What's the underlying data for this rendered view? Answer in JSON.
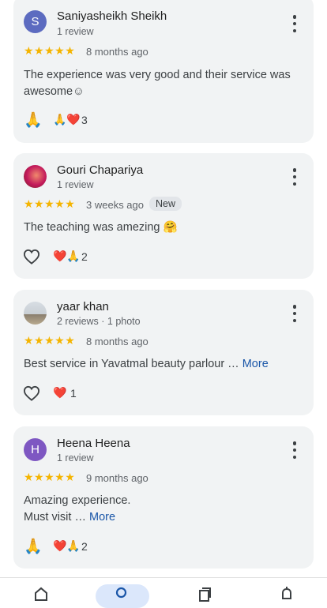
{
  "reviews": [
    {
      "avatar_letter": "S",
      "avatar_color": "#5c6bc0",
      "name": "Saniyasheikh Sheikh",
      "meta": "1 review",
      "stars": "★★★★★",
      "ago": "8 months ago",
      "text": "The experience was very good and their service was awesome☺",
      "reaction_icon": "🙏",
      "reactions": "🙏❤️",
      "count": "3"
    },
    {
      "name": "Gouri Chapariya",
      "meta": "1 review",
      "stars": "★★★★★",
      "ago": "3 weeks ago",
      "badge": "New",
      "text": "The teaching was amezing 🤗",
      "reaction_icon": "heart-outline-icon",
      "reactions": "❤️🙏",
      "count": "2"
    },
    {
      "name": "yaar khan",
      "meta": "2 reviews · 1 photo",
      "stars": "★★★★★",
      "ago": "8 months ago",
      "text": "Best service in Yavatmal beauty parlour … ",
      "more": "More",
      "reaction_icon": "heart-outline-icon",
      "reactions": "❤️",
      "count": "1"
    },
    {
      "avatar_letter": "H",
      "avatar_color": "#7e57c2",
      "name": "Heena Heena",
      "meta": "1 review",
      "stars": "★★★★★",
      "ago": "9 months ago",
      "text_line1": "Amazing experience.",
      "text_line2": "Must visit … ",
      "more": "More",
      "reaction_icon": "🙏",
      "reactions": "❤️🙏",
      "count": "2"
    }
  ],
  "colors": {
    "star": "#f4b400",
    "link": "#1a56a8",
    "card_bg": "#f1f3f4"
  },
  "bottom_nav": [
    "home-icon",
    "search-icon",
    "saved-icon",
    "notifications-icon"
  ]
}
